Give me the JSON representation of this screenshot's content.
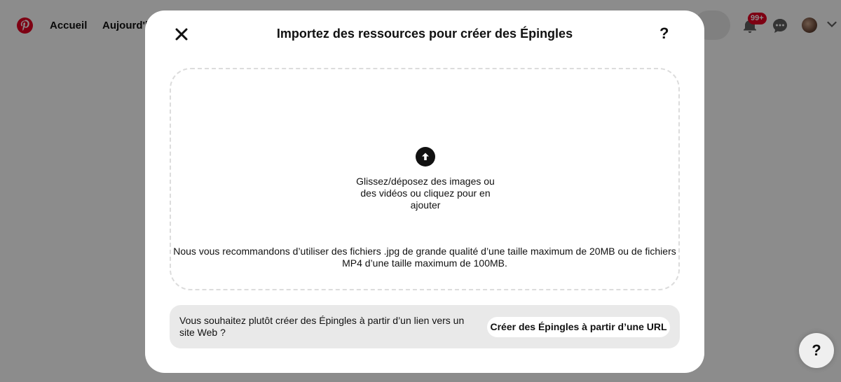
{
  "header": {
    "logo_icon": "pinterest-logo-icon",
    "nav": {
      "home": "Accueil",
      "today": "Aujourd'h"
    },
    "notifications_badge": "99+",
    "icons": [
      "bell-icon",
      "chat-icon",
      "avatar",
      "chevron-down-icon"
    ]
  },
  "modal": {
    "title": "Importez des ressources pour créer des Épingles",
    "help_label": "?",
    "dropzone": {
      "instruction": "Glissez/déposez des images ou des vidéos ou cliquez pour en ajouter",
      "recommendation": "Nous vous recommandons d’utiliser des fichiers .jpg de grande qualité d’une taille maximum de 20MB ou de fichiers MP4 d’une taille maximum de 100MB."
    },
    "url_panel": {
      "prompt": "Vous souhaitez plutôt créer des Épingles à partir d’un lien vers un site Web ?",
      "button_label": "Créer des Épingles à partir d’une URL"
    }
  },
  "help_fab": {
    "label": "?"
  },
  "colors": {
    "brand": "#e60023",
    "overlay": "rgba(0,0,0,0.45)",
    "panel": "#e9e9e9"
  }
}
